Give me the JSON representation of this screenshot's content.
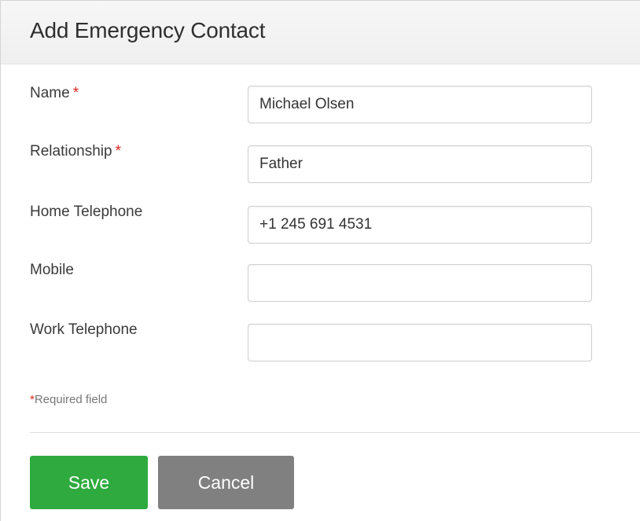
{
  "dialog": {
    "title": "Add Emergency Contact"
  },
  "fields": [
    {
      "label": "Name",
      "required_marker": "*",
      "value": "Michael Olsen"
    },
    {
      "label": "Relationship",
      "required_marker": "*",
      "value": "Father"
    },
    {
      "label": "Home Telephone",
      "required_marker": "",
      "value": "+1 245 691 4531"
    },
    {
      "label": "Mobile",
      "required_marker": "",
      "value": ""
    },
    {
      "label": "Work Telephone",
      "required_marker": "",
      "value": ""
    }
  ],
  "required_note": {
    "marker": "*",
    "text": "Required field"
  },
  "actions": {
    "save_label": "Save",
    "cancel_label": "Cancel"
  },
  "colors": {
    "save_button": "#2eaa3f",
    "cancel_button": "#808080",
    "required_star": "#d9261c"
  }
}
